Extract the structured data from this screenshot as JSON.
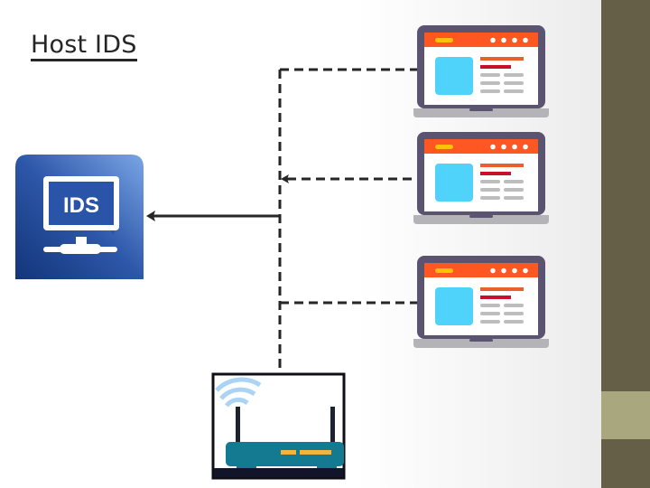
{
  "slide": {
    "title": "Host IDS"
  },
  "ids_icon": {
    "label": "IDS",
    "colors": {
      "dark": "#1d3f8a",
      "light": "#6f9de0"
    }
  },
  "hosts": [
    {
      "name": "laptop-1"
    },
    {
      "name": "laptop-2"
    },
    {
      "name": "laptop-3"
    }
  ],
  "router": {
    "name": "wireless-router"
  },
  "colors": {
    "line": "#262626",
    "laptop_frame": "#5b5470",
    "laptop_base": "#b3b3b8",
    "browser_header": "#ff5722",
    "browser_logo": "#ffc107",
    "image_block": "#4fd3fb",
    "text_bar_orange": "#e8602c",
    "text_bar_red": "#c8102e",
    "text_bar_gray": "#bdbdbd",
    "router_body": "#147a91",
    "router_led": "#f2b53a",
    "wifi": "#aad4f5",
    "sidebar": "#665f48",
    "sidebar_accent": "#a8a77e"
  }
}
